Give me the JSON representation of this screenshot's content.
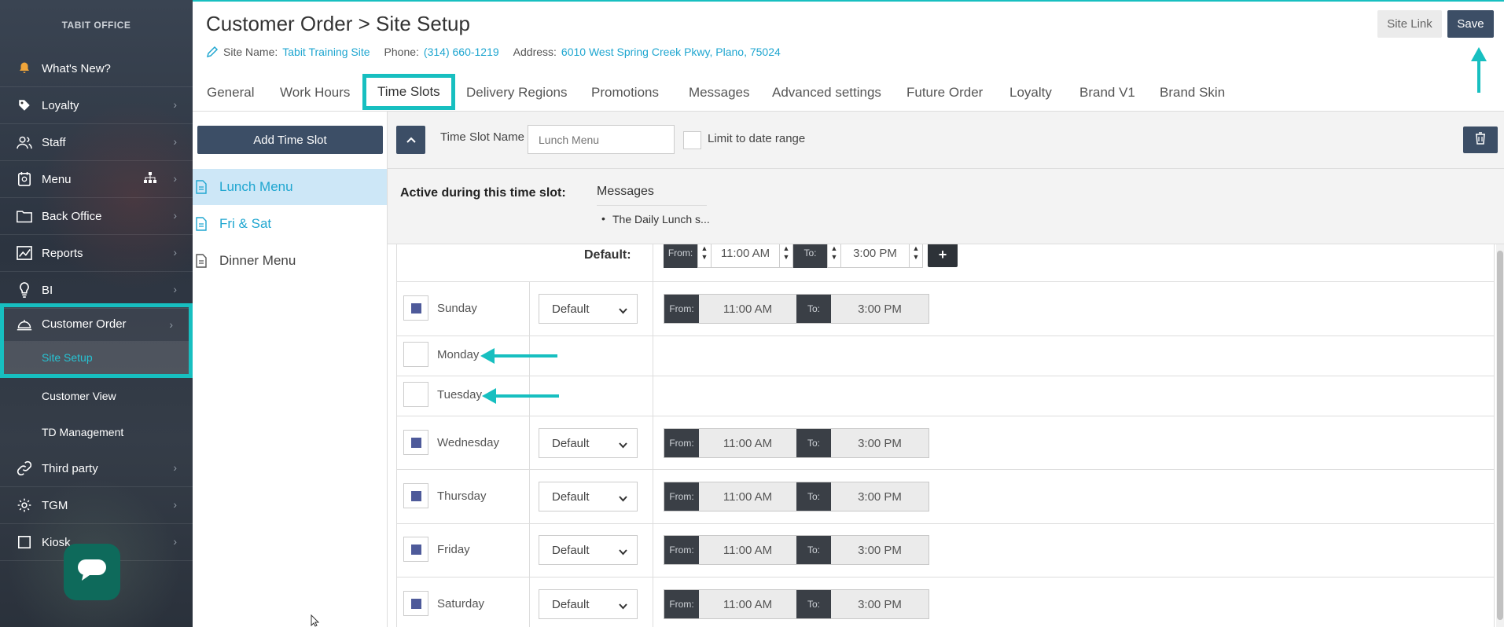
{
  "sidebar": {
    "brand": "TABIT OFFICE",
    "items": [
      {
        "label": "What's New?"
      },
      {
        "label": "Loyalty"
      },
      {
        "label": "Staff"
      },
      {
        "label": "Menu"
      },
      {
        "label": "Back Office"
      },
      {
        "label": "Reports"
      },
      {
        "label": "BI"
      },
      {
        "label": "Customer Order"
      },
      {
        "label": "Site Setup"
      },
      {
        "label": "Customer View"
      },
      {
        "label": "TD Management"
      },
      {
        "label": "Third party"
      },
      {
        "label": "TGM"
      },
      {
        "label": "Kiosk"
      }
    ]
  },
  "header": {
    "title": "Customer Order > Site Setup",
    "site_name_label": "Site Name:",
    "site_name": "Tabit Training Site",
    "phone_label": "Phone:",
    "phone": "(314) 660-1219",
    "address_label": "Address:",
    "address": "6010 West Spring Creek Pkwy, Plano, 75024",
    "site_link_label": "Site Link",
    "save_label": "Save"
  },
  "tabs": [
    {
      "label": "General"
    },
    {
      "label": "Work Hours"
    },
    {
      "label": "Time Slots",
      "active": true
    },
    {
      "label": "Delivery Regions"
    },
    {
      "label": "Promotions"
    },
    {
      "label": "Messages"
    },
    {
      "label": "Advanced settings"
    },
    {
      "label": "Future Order"
    },
    {
      "label": "Loyalty"
    },
    {
      "label": "Brand V1"
    },
    {
      "label": "Brand Skin"
    }
  ],
  "time_slot_list": {
    "add_label": "Add Time Slot",
    "items": [
      {
        "label": "Lunch Menu",
        "selected": true
      },
      {
        "label": "Fri & Sat"
      },
      {
        "label": "Dinner Menu"
      }
    ]
  },
  "editor": {
    "name_label": "Time Slot Name",
    "name_placeholder": "Lunch Menu",
    "limit_label": "Limit to date range",
    "active_label": "Active during this time slot:",
    "messages_title": "Messages",
    "messages": [
      "The Daily Lunch s..."
    ]
  },
  "schedule": {
    "default_label": "Default:",
    "from_label": "From:",
    "to_label": "To:",
    "default_from": "11:00 AM",
    "default_to": "3:00 PM",
    "plus": "+",
    "select_value": "Default",
    "days": [
      {
        "name": "Sunday",
        "enabled": true,
        "from": "11:00 AM",
        "to": "3:00 PM"
      },
      {
        "name": "Monday",
        "enabled": false
      },
      {
        "name": "Tuesday",
        "enabled": false
      },
      {
        "name": "Wednesday",
        "enabled": true,
        "from": "11:00 AM",
        "to": "3:00 PM"
      },
      {
        "name": "Thursday",
        "enabled": true,
        "from": "11:00 AM",
        "to": "3:00 PM"
      },
      {
        "name": "Friday",
        "enabled": true,
        "from": "11:00 AM",
        "to": "3:00 PM"
      },
      {
        "name": "Saturday",
        "enabled": true,
        "from": "11:00 AM",
        "to": "3:00 PM"
      }
    ]
  },
  "colors": {
    "accent": "#17bfc0",
    "primary_button": "#3c4e66",
    "link": "#1fa6d0",
    "selected_row": "#cde7f7",
    "checkbox_fill": "#4e5a9a"
  }
}
